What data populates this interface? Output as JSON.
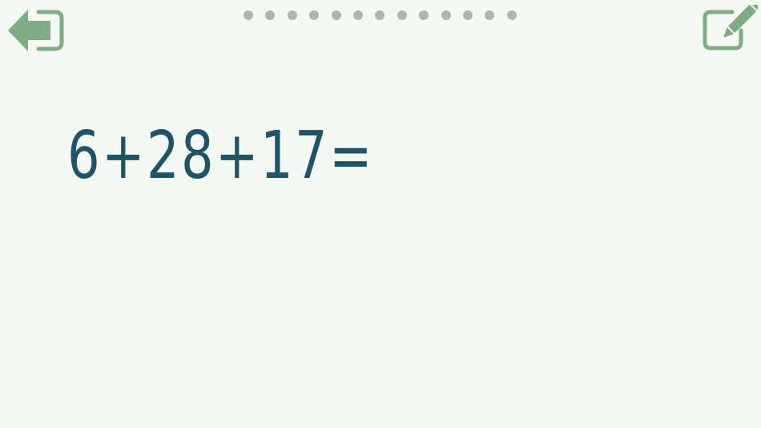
{
  "colors": {
    "background": "#f4f9f3",
    "icon_green": "#7fac85",
    "dot_grey": "#b3b3b3",
    "equation_text": "#1f5468"
  },
  "toolbar": {
    "back_icon": "exit-arrow-icon",
    "edit_icon": "pencil-edit-icon"
  },
  "progress": {
    "total_steps": 13
  },
  "problem": {
    "equation": "6+28+17="
  }
}
